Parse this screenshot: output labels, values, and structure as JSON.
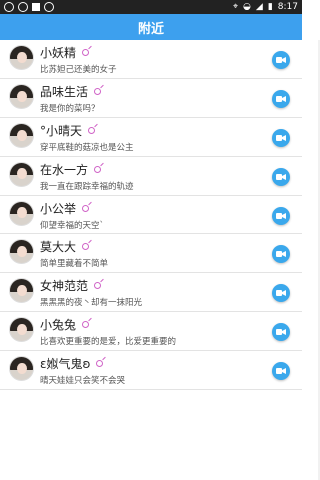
{
  "status": {
    "time": "8:17"
  },
  "appbar": {
    "title": "附近"
  },
  "users": [
    {
      "name": "小妖精",
      "signature": "比苏妲己还美的女子"
    },
    {
      "name": "品味生活",
      "signature": "我是你的菜吗？"
    },
    {
      "name": "°小晴天",
      "signature": "穿平底鞋的菇凉也是公主"
    },
    {
      "name": "在水一方",
      "signature": "我一直在跟踪幸福的轨迹"
    },
    {
      "name": "小公举",
      "signature": "仰望幸福的天空`"
    },
    {
      "name": "莫大大",
      "signature": "简单里藏着不简单"
    },
    {
      "name": "女神范范",
      "signature": "黑黑黑的夜丶却有一抹阳光"
    },
    {
      "name": "小兔兔",
      "signature": "比喜欢更重要的是爱，比爱更重要的"
    },
    {
      "name": "ε娰气鬼ʚ",
      "signature": "晴天娃娃只会笑不会哭"
    }
  ]
}
